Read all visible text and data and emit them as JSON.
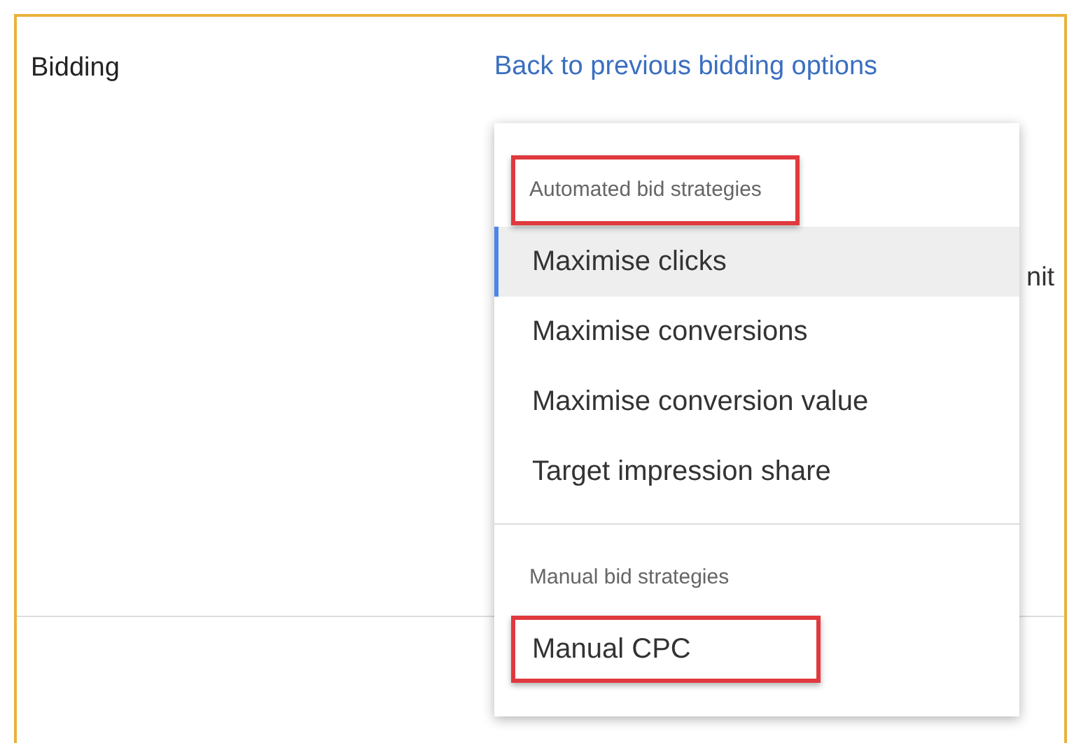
{
  "section": {
    "title": "Bidding",
    "link": "Back to previous bidding options",
    "hidden_text": "nit"
  },
  "menu": {
    "groups": [
      {
        "header": "Automated bid strategies",
        "highlighted": true,
        "items": [
          {
            "label": "Maximise clicks",
            "selected": true,
            "highlighted": false
          },
          {
            "label": "Maximise conversions",
            "selected": false,
            "highlighted": false
          },
          {
            "label": "Maximise conversion value",
            "selected": false,
            "highlighted": false
          },
          {
            "label": "Target impression share",
            "selected": false,
            "highlighted": false
          }
        ]
      },
      {
        "header": "Manual bid strategies",
        "highlighted": false,
        "items": [
          {
            "label": "Manual CPC",
            "selected": false,
            "highlighted": true
          }
        ]
      }
    ]
  }
}
